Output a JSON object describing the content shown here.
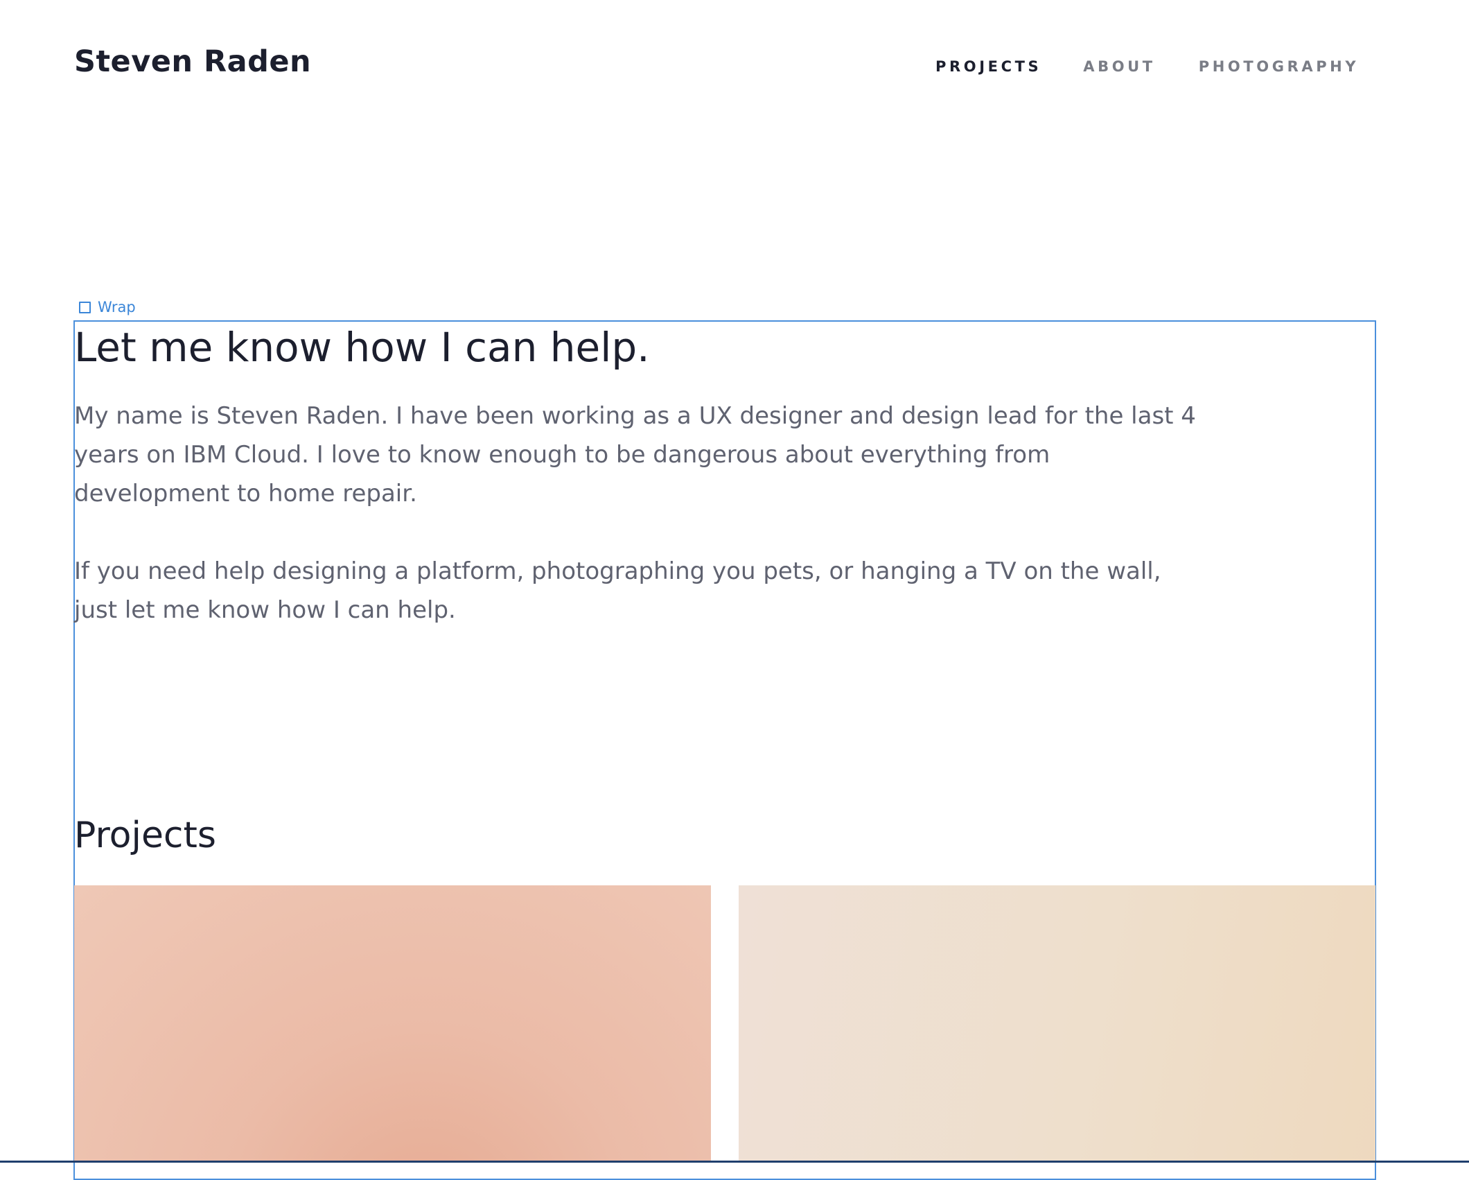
{
  "header": {
    "brand": "Steven Raden",
    "nav": [
      {
        "label": "PROJECTS",
        "active": true
      },
      {
        "label": "ABOUT",
        "active": false
      },
      {
        "label": "PHOTOGRAPHY",
        "active": false
      }
    ]
  },
  "editor": {
    "wrap_label": "Wrap",
    "accent": "#3b86d8"
  },
  "hero": {
    "title": "Let me know how I can help.",
    "paragraphs": [
      "My name is Steven Raden. I have been working as a UX designer and design lead for the last 4 years on IBM Cloud. I love to know enough to be dangerous about everything from development to home repair.",
      "If you need help designing a platform, photographing you pets, or hanging a TV on the wall, just let me know how I can help."
    ]
  },
  "projects": {
    "title": "Projects"
  },
  "colors": {
    "text_dark": "#1c1f2e",
    "text_muted": "#5f6270",
    "nav_muted": "#7a7d86",
    "card_1": "#ecbca8",
    "card_2": "#eeddc9"
  }
}
